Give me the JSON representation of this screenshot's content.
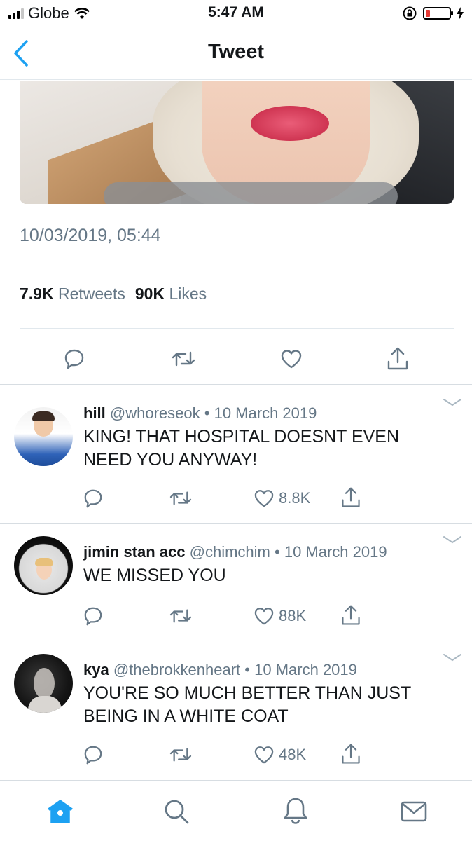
{
  "status_bar": {
    "carrier": "Globe",
    "time": "5:47 AM",
    "battery_level": 0.2
  },
  "nav": {
    "title": "Tweet"
  },
  "tweet": {
    "timestamp": "10/03/2019, 05:44",
    "retweets_count": "7.9K",
    "retweets_label": "Retweets",
    "likes_count": "90K",
    "likes_label": "Likes"
  },
  "replies": [
    {
      "name": "hill",
      "handle": "@whoreseok",
      "date": "10 March 2019",
      "text_line1": "KING! THAT HOSPITAL DOESNT EVEN",
      "text_line2": "NEED YOU ANYWAY!",
      "likes": "8.8K"
    },
    {
      "name": "jimin stan acc",
      "handle": "@chimchim",
      "date": "10 March 2019",
      "text_line1": "WE MISSED YOU",
      "text_line2": "",
      "likes": "88K"
    },
    {
      "name": "kya",
      "handle": "@thebrokkenheart",
      "date": "10 March 2019",
      "text_line1": "YOU'RE SO MUCH BETTER THAN JUST",
      "text_line2": "BEING IN A WHITE COAT",
      "likes": "48K"
    }
  ],
  "separator": "•",
  "colors": {
    "accent": "#1da1f2",
    "secondary_text": "#657786",
    "icon_gray": "#657786",
    "battery_low": "#e53935"
  },
  "icons": {
    "tab_home": "home-icon",
    "tab_search": "search-icon",
    "tab_notifications": "bell-icon",
    "tab_messages": "mail-icon"
  }
}
